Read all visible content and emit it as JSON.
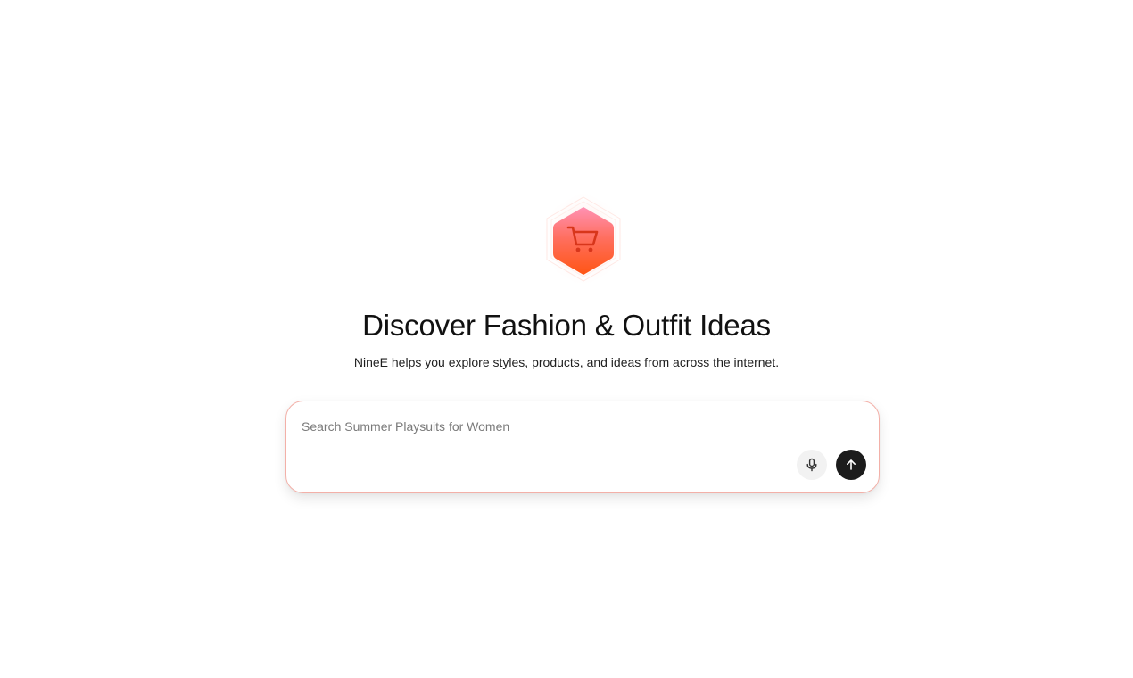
{
  "hero": {
    "title": "Discover Fashion & Outfit Ideas",
    "subtitle": "NineE helps you explore styles, products, and ideas from across the internet."
  },
  "search": {
    "placeholder": "Search Summer Playsuits for Women",
    "value": ""
  },
  "icons": {
    "logo": "shopping-cart-icon",
    "mic": "microphone-icon",
    "send": "arrow-up-icon"
  },
  "colors": {
    "logo_gradient_top": "#ff8fb0",
    "logo_gradient_bottom": "#ff5a1f",
    "card_border": "#f3b0a8",
    "send_button": "#1c1c1c",
    "mic_button": "#f2f2f2"
  }
}
